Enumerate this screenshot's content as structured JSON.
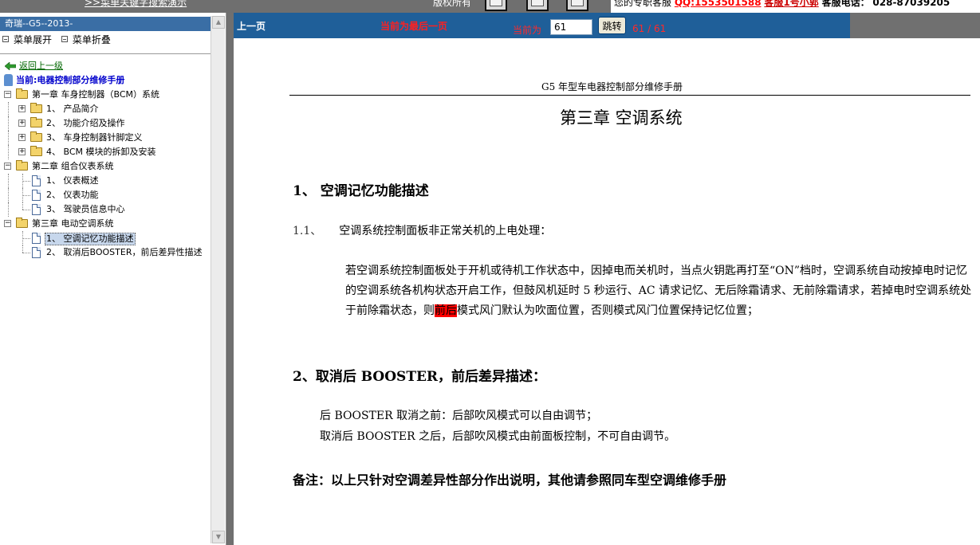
{
  "topbar": {
    "search_demo": ">>菜单关键字搜索演示",
    "stray_text": "版权所有",
    "qq_prefix": "您的专职客服",
    "qq_number": "QQ:1553501588",
    "service_name": "客服1号小郭",
    "phone_label": "客服电话：",
    "phone_number": "028-87039205"
  },
  "left": {
    "title": "奇瑞--G5--2013-",
    "expand_label": "菜单展开",
    "collapse_label": "菜单折叠",
    "back_label": "返回上一级",
    "current_label": "当前:电器控制部分维修手册",
    "tree": [
      {
        "label": "第一章 车身控制器（BCM）系统"
      },
      {
        "label": "1、 产品简介"
      },
      {
        "label": "2、 功能介绍及操作"
      },
      {
        "label": "3、 车身控制器针脚定义"
      },
      {
        "label": "4、 BCM 模块的拆卸及安装"
      },
      {
        "label": "第二章 组合仪表系统"
      },
      {
        "label": "1、 仪表概述"
      },
      {
        "label": "2、 仪表功能"
      },
      {
        "label": "3、 驾驶员信息中心"
      },
      {
        "label": "第三章 电动空调系统"
      },
      {
        "label": "1、 空调记忆功能描述"
      },
      {
        "label": "2、 取消后BOOSTER，前后差异性描述"
      }
    ]
  },
  "toolbar": {
    "prev_label": "上一页",
    "last_page_msg": "当前为最后一页",
    "current_label": "当前为",
    "page_value": "61",
    "jump_label": "跳转",
    "page_count": "61 / 61"
  },
  "document": {
    "header": "G5 年型车电器控制部分维修手册",
    "chapter_title": "第三章  空调系统",
    "section1_title": "1、  空调记忆功能描述",
    "subsection_num": "1.1、",
    "subsection_title": "空调系统控制面板非正常关机的上电处理：",
    "para_before": "若空调系统控制面板处于开机或待机工作状态中，因掉电而关机时，当点火钥匙再打至“ON”档时，空调系统自动按掉电时记忆的空调系统各机构状态开启工作，但鼓风机延时 5 秒运行、AC 请求记忆、无后除霜请求、无前除霜请求，若掉电时空调系统处于前除霜状态，则",
    "para_highlight": "前后",
    "para_after": "模式风门默认为吹面位置，否则模式风门位置保持记忆位置；",
    "section2_title": "2、取消后 BOOSTER，前后差异描述：",
    "line1": "后 BOOSTER 取消之前：后部吹风模式可以自由调节；",
    "line2": "取消后 BOOSTER 之后，后部吹风模式由前面板控制，不可自由调节。",
    "note": "备注：以上只针对空调差异性部分作出说明，其他请参照同车型空调维修手册"
  },
  "colors": {
    "toolbar_bg": "#1f5f99",
    "left_title_bg": "#3a6ea5",
    "frame_bg": "#707070",
    "highlight": "#ff0000"
  }
}
